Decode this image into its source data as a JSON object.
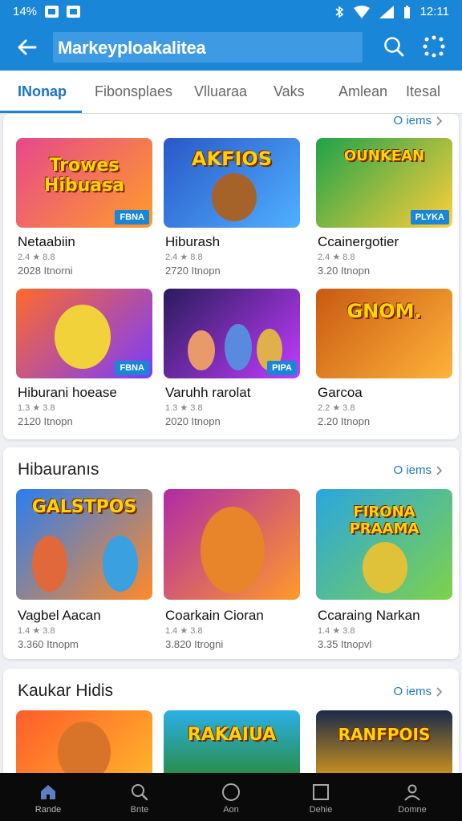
{
  "status": {
    "left": "14%",
    "time": "12:11"
  },
  "appbar": {
    "title": "Markeyploakaliteа"
  },
  "tabs": [
    "INonap",
    "Fibonsplaes",
    "Vlluaraa",
    "Vaks",
    "Amlean",
    "Itesal"
  ],
  "section1": {
    "more": "O iems",
    "cards": [
      {
        "name": "Netaabiin",
        "sub1": "2.4 ★ 8.8",
        "sub2": "2028 Itnorni",
        "art": "Trowes Hibuasa",
        "badge": "FBNA",
        "bg": [
          "#e6488c",
          "#ff9c2a"
        ]
      },
      {
        "name": "Hiburash",
        "sub1": "2.4 ★ 8.8",
        "sub2": "2720 Itnopn",
        "art": "AKFIOS",
        "badge": "",
        "bg": [
          "#2a58c8",
          "#4fb0ff"
        ]
      },
      {
        "name": "Ccainergotier",
        "sub1": "2.4 ★ 8.8",
        "sub2": "3.20 Itnopn",
        "art": "OUNKEAN",
        "badge": "PLYKA",
        "bg": [
          "#1ea34a",
          "#ffce3a"
        ]
      },
      {
        "name": "Hiburani hoease",
        "sub1": "1.3 ★ 3.8",
        "sub2": "2120 Itnopn",
        "art": "",
        "badge": "FBNA",
        "bg": [
          "#ff6a2a",
          "#7a3cff"
        ]
      },
      {
        "name": "Varuhh rarolat",
        "sub1": "1.3 ★ 3.8",
        "sub2": "2020 Itnopn",
        "art": "",
        "badge": "PIPA",
        "bg": [
          "#2a1b5c",
          "#c23cff"
        ]
      },
      {
        "name": "Garcoa",
        "sub1": "2.2 ★ 3.8",
        "sub2": "2.20 Itnopn",
        "art": "GNOM.",
        "badge": "",
        "bg": [
          "#c85a12",
          "#ffb23a"
        ]
      }
    ]
  },
  "section2": {
    "title": "Hibauranıs",
    "more": "O iems",
    "cards": [
      {
        "name": "Vagbel Aacan",
        "sub1": "1.4 ★ 3.8",
        "sub2": "3.360 Itnopm",
        "art": "GALSTPOS",
        "badge": "",
        "bg": [
          "#2a7ef0",
          "#ff8a2a"
        ]
      },
      {
        "name": "Coarkain Cioran",
        "sub1": "1.4 ★ 3.8",
        "sub2": "3.820 Itrogni",
        "art": "",
        "badge": "",
        "bg": [
          "#b02aa8",
          "#ff9a2a"
        ]
      },
      {
        "name": "Ccaraing Narkan",
        "sub1": "1.4 ★ 3.8",
        "sub2": "3.35 Itnopvl",
        "art": "FIRONA PRAAMA",
        "badge": "",
        "bg": [
          "#2aa6e0",
          "#7ed24a"
        ]
      }
    ]
  },
  "section3": {
    "title": "Kaukar Hidis",
    "more": "O iems",
    "cards": [
      {
        "art": "",
        "bg": [
          "#ff5c2a",
          "#ffb52a"
        ]
      },
      {
        "art": "RAKAIUA",
        "bg": [
          "#2ab0e8",
          "#2a8a3a"
        ]
      },
      {
        "art": "RANFPOIS",
        "bg": [
          "#1a2a4a",
          "#d89a1a"
        ]
      }
    ]
  },
  "nav": [
    "Rande",
    "Bnte",
    "Aon",
    "Dehie",
    "Domne"
  ]
}
